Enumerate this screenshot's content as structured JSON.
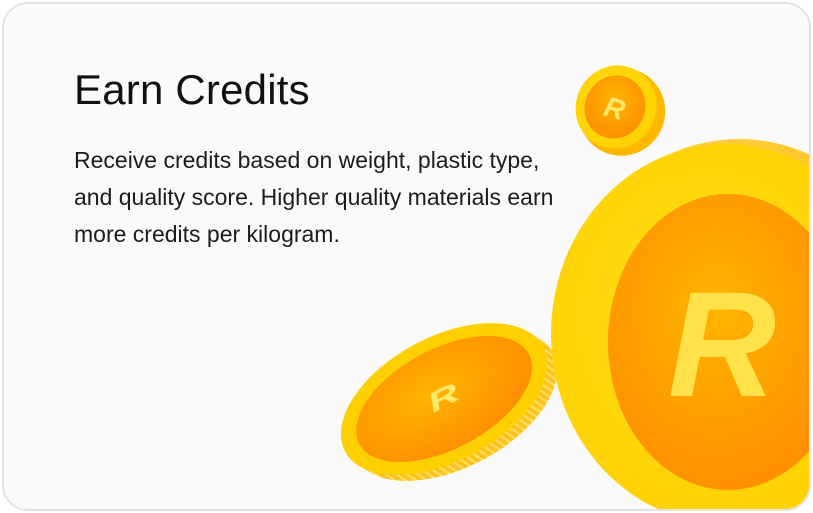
{
  "card": {
    "title": "Earn Credits",
    "description": "Receive credits based on weight, plastic type, and quality score. Higher quality materials earn more credits per kilogram."
  },
  "illustration": {
    "icon": "coin-icon",
    "colors": {
      "coin_face": "#ffd400",
      "coin_center": "#ff9e00",
      "coin_edge": "#ffb800",
      "glyph": "#ffe96a"
    }
  }
}
